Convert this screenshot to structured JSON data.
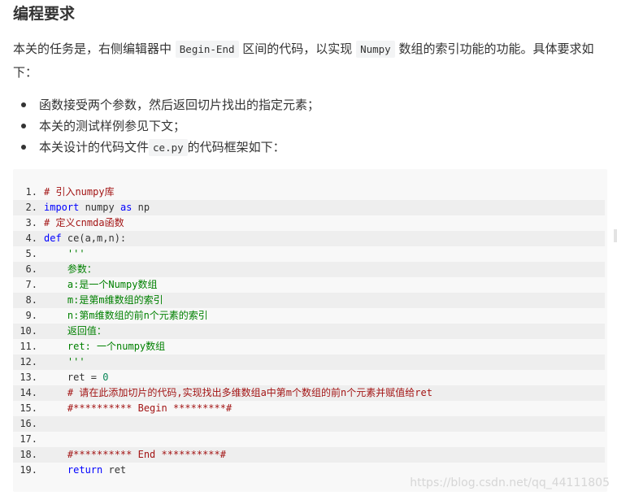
{
  "section_title": "编程要求",
  "intro": {
    "part1": "本关的任务是，右侧编辑器中 ",
    "code1": "Begin-End",
    "part2": " 区间的代码，以实现 ",
    "code2": "Numpy",
    "part3": " 数组的索引功能的功能。具体要求如下："
  },
  "bullets": [
    {
      "text": "函数接受两个参数，然后返回切片找出的指定元素；"
    },
    {
      "text": "本关的测试样例参见下文；"
    },
    {
      "text_before": "本关设计的代码文件",
      "code": "ce.py",
      "text_after": "的代码框架如下："
    }
  ],
  "code_lines": [
    {
      "num": "1.",
      "segments": [
        {
          "t": "# 引入numpy库",
          "c": "cm"
        }
      ]
    },
    {
      "num": "2.",
      "segments": [
        {
          "t": "import",
          "c": "kw"
        },
        {
          "t": " numpy ",
          "c": "pl"
        },
        {
          "t": "as",
          "c": "kw"
        },
        {
          "t": " np",
          "c": "pl"
        }
      ]
    },
    {
      "num": "3.",
      "segments": [
        {
          "t": "# 定义cnmda函数",
          "c": "cm"
        }
      ]
    },
    {
      "num": "4.",
      "segments": [
        {
          "t": "def",
          "c": "kw"
        },
        {
          "t": " ce(a,m,n):",
          "c": "pl"
        }
      ]
    },
    {
      "num": "5.",
      "segments": [
        {
          "t": "    '''",
          "c": "str"
        }
      ]
    },
    {
      "num": "6.",
      "segments": [
        {
          "t": "    参数：",
          "c": "str"
        }
      ]
    },
    {
      "num": "7.",
      "segments": [
        {
          "t": "    a:是一个Numpy数组",
          "c": "str"
        }
      ]
    },
    {
      "num": "8.",
      "segments": [
        {
          "t": "    m:是第m维数组的索引",
          "c": "str"
        }
      ]
    },
    {
      "num": "9.",
      "segments": [
        {
          "t": "    n:第m维数组的前n个元素的索引",
          "c": "str"
        }
      ]
    },
    {
      "num": "10.",
      "segments": [
        {
          "t": "    返回值：",
          "c": "str"
        }
      ]
    },
    {
      "num": "11.",
      "segments": [
        {
          "t": "    ret: 一个numpy数组",
          "c": "str"
        }
      ]
    },
    {
      "num": "12.",
      "segments": [
        {
          "t": "    '''",
          "c": "str"
        }
      ]
    },
    {
      "num": "13.",
      "segments": [
        {
          "t": "    ret = ",
          "c": "pl"
        },
        {
          "t": "0",
          "c": "num"
        }
      ]
    },
    {
      "num": "14.",
      "segments": [
        {
          "t": "    # 请在此添加切片的代码,实现找出多维数组a中第m个数组的前n个元素并赋值给ret",
          "c": "cm"
        }
      ]
    },
    {
      "num": "15.",
      "segments": [
        {
          "t": "    #********** Begin *********#",
          "c": "cm"
        }
      ]
    },
    {
      "num": "16.",
      "segments": []
    },
    {
      "num": "17.",
      "segments": []
    },
    {
      "num": "18.",
      "segments": [
        {
          "t": "    #********** End **********#",
          "c": "cm"
        }
      ]
    },
    {
      "num": "19.",
      "segments": [
        {
          "t": "    return",
          "c": "kw"
        },
        {
          "t": " ret",
          "c": "pl"
        }
      ]
    }
  ],
  "watermark": "https://blog.csdn.net/qq_44111805"
}
